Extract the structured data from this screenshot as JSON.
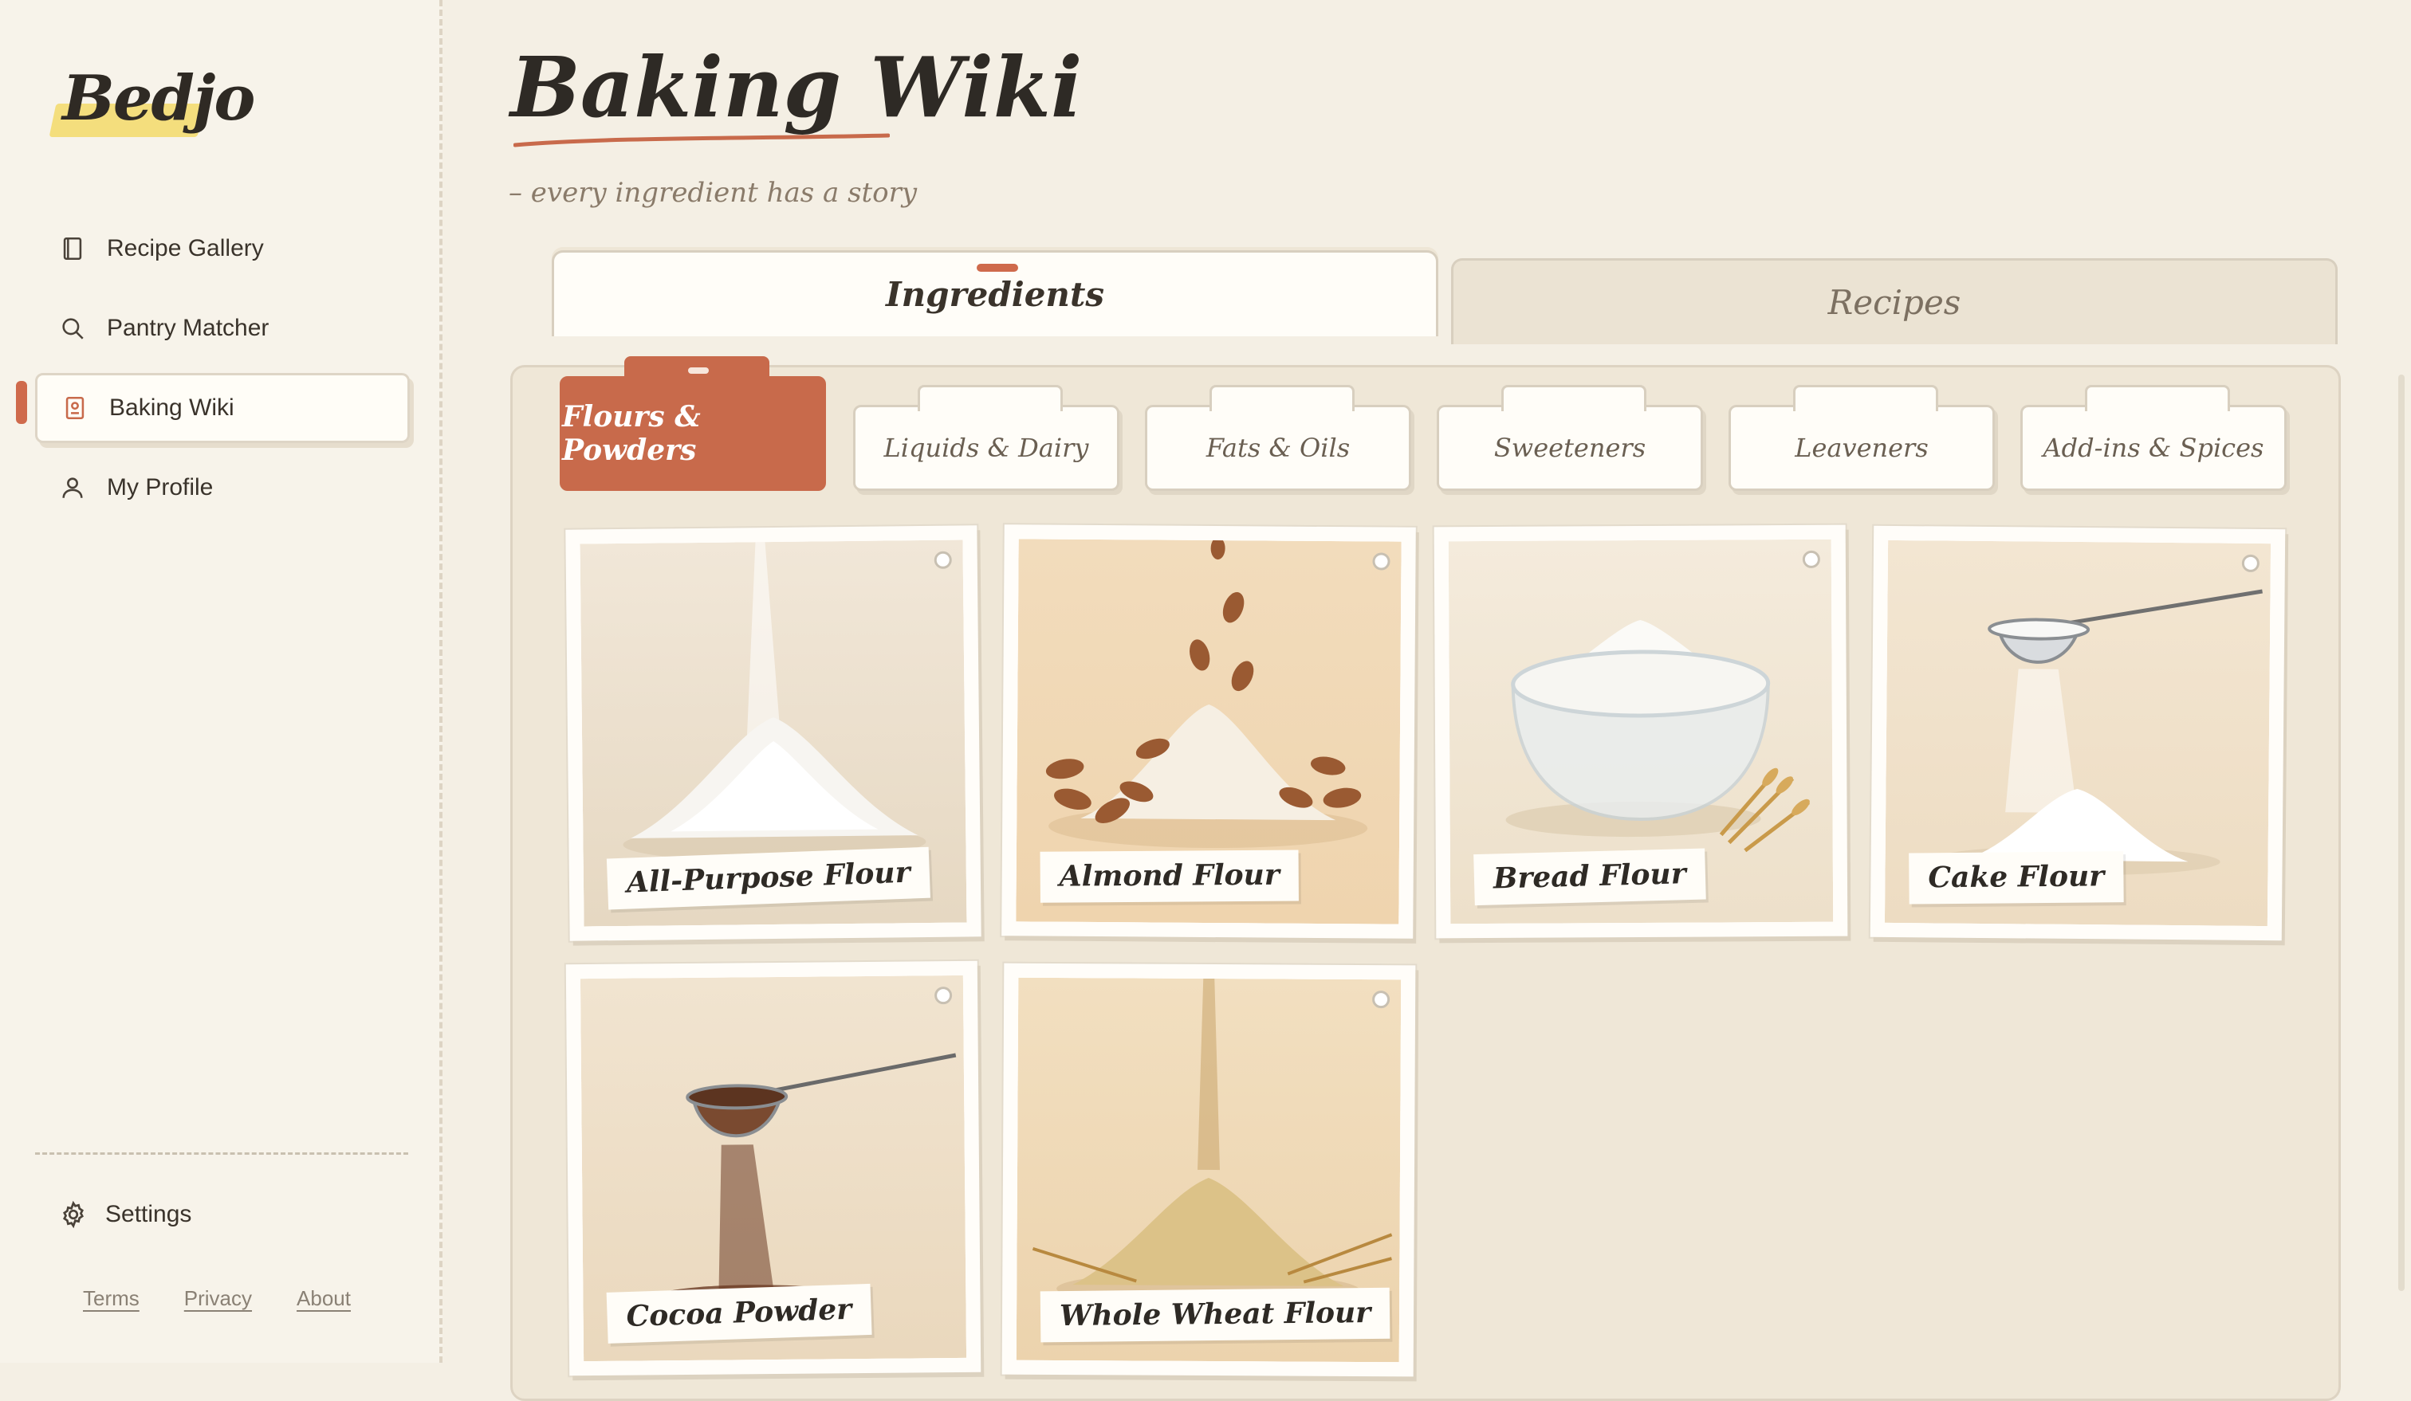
{
  "app": {
    "logo": "Bedjo"
  },
  "sidebar": {
    "items": [
      {
        "label": "Recipe Gallery",
        "icon": "book-icon"
      },
      {
        "label": "Pantry Matcher",
        "icon": "search-icon"
      },
      {
        "label": "Baking Wiki",
        "icon": "wiki-book-icon",
        "active": true
      },
      {
        "label": "My Profile",
        "icon": "user-icon"
      }
    ],
    "settings": "Settings",
    "footer": {
      "terms": "Terms",
      "privacy": "Privacy",
      "about": "About"
    }
  },
  "page": {
    "title": "Baking Wiki",
    "tagline": "– every ingredient has a story"
  },
  "main_tabs": [
    {
      "label": "Ingredients",
      "active": true
    },
    {
      "label": "Recipes",
      "active": false
    }
  ],
  "categories": [
    {
      "label": "Flours & Powders",
      "active": true
    },
    {
      "label": "Liquids & Dairy"
    },
    {
      "label": "Fats & Oils"
    },
    {
      "label": "Sweeteners"
    },
    {
      "label": "Leaveners"
    },
    {
      "label": "Add-ins & Spices"
    }
  ],
  "ingredients": [
    {
      "name": "All-Purpose Flour"
    },
    {
      "name": "Almond Flour"
    },
    {
      "name": "Bread Flour"
    },
    {
      "name": "Cake Flour"
    },
    {
      "name": "Cocoa Powder"
    },
    {
      "name": "Whole Wheat Flour"
    }
  ],
  "colors": {
    "accent": "#c86a4b",
    "background": "#f4efe4",
    "highlight": "#f3d96a"
  }
}
